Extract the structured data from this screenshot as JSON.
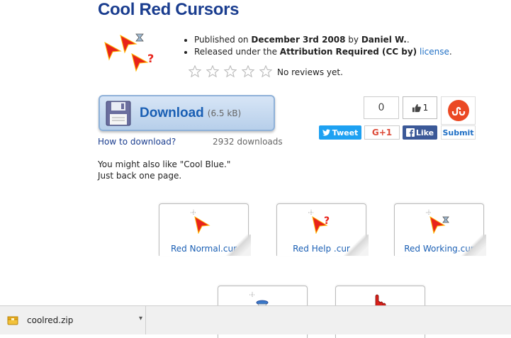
{
  "page": {
    "title": "Cool Red Cursors"
  },
  "meta": {
    "published_prefix": "Published on ",
    "published_date": "December 3rd 2008",
    "by": " by ",
    "author": "Daniel W.",
    "author_suffix": ".",
    "released_prefix": "Released under the ",
    "license_name": "Attribution Required (CC by)",
    "license_link": "license",
    "license_suffix": "."
  },
  "rating": {
    "stars_filled": 0,
    "stars_total": 5,
    "text": "No reviews yet."
  },
  "download": {
    "label": "Download",
    "size": "(6.5 kB)",
    "how_to": "How to download?",
    "count": "2932 downloads"
  },
  "suggestion": {
    "line1": "You might also like \"Cool Blue.\"",
    "line2": "Just back one page."
  },
  "social": {
    "tweet_count": "0",
    "fb_like_count": "1",
    "tweet_label": "Tweet",
    "gplus_label": "G+1",
    "like_label": "Like",
    "submit_label": "Submit",
    "colors": {
      "twitter": "#1da1f2",
      "facebook": "#3b5998",
      "stumbleupon": "#eb4924",
      "gplus": "#dd4b39"
    }
  },
  "cursors": [
    {
      "label": "Red Normal.cur",
      "icon": "red-arrow-cursor-icon"
    },
    {
      "label": "Red Help .cur",
      "icon": "red-help-cursor-icon"
    },
    {
      "label": "Red Working.cur",
      "icon": "red-working-cursor-icon"
    },
    {
      "label": "",
      "icon": "red-busy-cursor-icon"
    },
    {
      "label": "",
      "icon": "red-hand-cursor-icon"
    }
  ],
  "download_bar": {
    "file_name": "coolred.zip"
  },
  "colors": {
    "title": "#1a3d8f",
    "link": "#1f6fc5",
    "button_blue": "#1a5fb4",
    "cursor_red": "#e8231b"
  }
}
